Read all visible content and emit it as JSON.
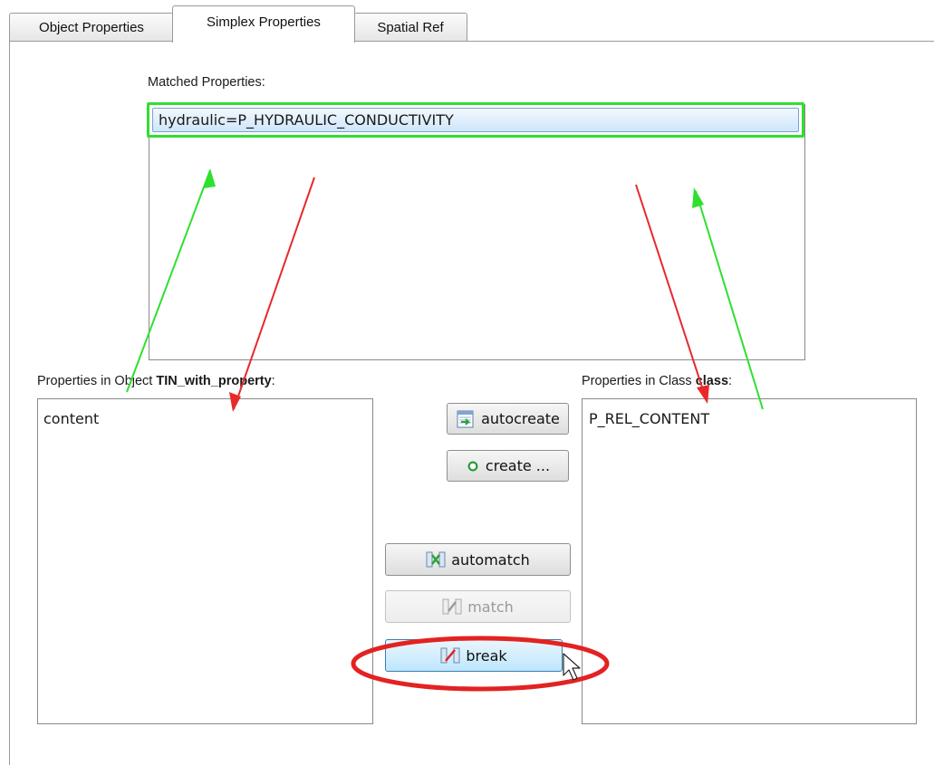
{
  "tabs": [
    {
      "label": "Object Properties",
      "active": false
    },
    {
      "label": "Simplex Properties",
      "active": true
    },
    {
      "label": "Spatial Ref",
      "active": false
    }
  ],
  "matched": {
    "label": "Matched Properties:",
    "items": [
      "hydraulic=P_HYDRAULIC_CONDUCTIVITY"
    ]
  },
  "object_props": {
    "label_prefix": "Properties in Object ",
    "label_name": "TIN_with_property",
    "label_suffix": ":",
    "items": [
      "content"
    ]
  },
  "class_props": {
    "label_prefix": "Properties in Class ",
    "label_name": "class",
    "label_suffix": ":",
    "items": [
      "P_REL_CONTENT"
    ]
  },
  "buttons": {
    "autocreate": "autocreate",
    "create": "create ...",
    "automatch": "automatch",
    "match": "match",
    "break": "break"
  },
  "colors": {
    "highlight_green": "#33dd33",
    "annotation_red": "#e8292b",
    "annotation_green": "#2fe02f"
  }
}
